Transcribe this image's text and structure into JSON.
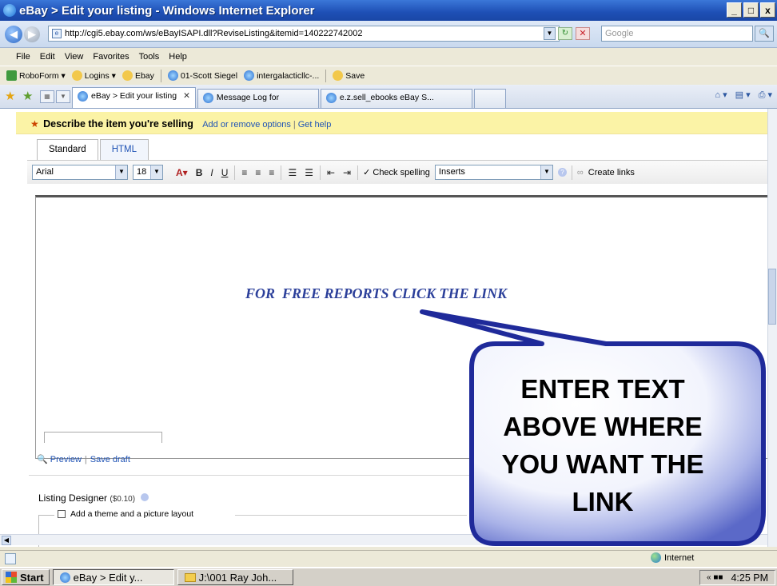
{
  "window": {
    "title": "eBay > Edit your listing - Windows Internet Explorer",
    "controls": [
      "_",
      "□",
      "x"
    ]
  },
  "address_bar": {
    "url": "http://cgi5.ebay.com/ws/eBayISAPI.dll?ReviseListing&itemid=140222742002",
    "search_placeholder": "Google"
  },
  "menu": [
    "File",
    "Edit",
    "View",
    "Favorites",
    "Tools",
    "Help"
  ],
  "links": [
    {
      "label": "RoboForm ▾",
      "icon": "roboform-icon"
    },
    {
      "label": "Logins ▾",
      "icon": "folder-icon"
    },
    {
      "label": "Ebay",
      "icon": "folder-icon"
    },
    {
      "label": "01-Scott Siegel",
      "icon": "ie-icon"
    },
    {
      "label": "intergalacticllc-...",
      "icon": "ie-icon"
    },
    {
      "label": "Save",
      "icon": "folder-icon"
    }
  ],
  "tabs": [
    {
      "label": "eBay > Edit your listing",
      "active": true
    },
    {
      "label": "Message Log for",
      "active": false
    },
    {
      "label": "e.z.sell_ebooks eBay S...",
      "active": false
    }
  ],
  "page": {
    "section_title": "Describe the item you're selling",
    "add_remove_options": "Add or remove options",
    "get_help": "Get help",
    "editor_tabs": [
      "Standard",
      "HTML"
    ],
    "toolbar": {
      "font": "Arial",
      "size": "18",
      "check_spelling": "Check spelling",
      "inserts": "Inserts",
      "create_links": "Create links"
    },
    "editor_text": "FOR  FREE REPORTS CLICK THE LINK",
    "preview": "Preview",
    "save_draft": "Save draft",
    "listing_designer": "Listing Designer",
    "listing_designer_price": "($0.10)",
    "theme_option": "Add a theme and a picture layout"
  },
  "callout": {
    "lines": [
      "ENTER TEXT",
      "ABOVE WHERE",
      "YOU WANT THE",
      "LINK"
    ],
    "fill": "#5b69c8",
    "border": "#1f2a9a"
  },
  "status": {
    "zone": "Internet"
  },
  "taskbar": {
    "start": "Start",
    "tasks": [
      "eBay > Edit y...",
      "J:\\001 Ray Joh..."
    ],
    "time": "4:25 PM"
  }
}
